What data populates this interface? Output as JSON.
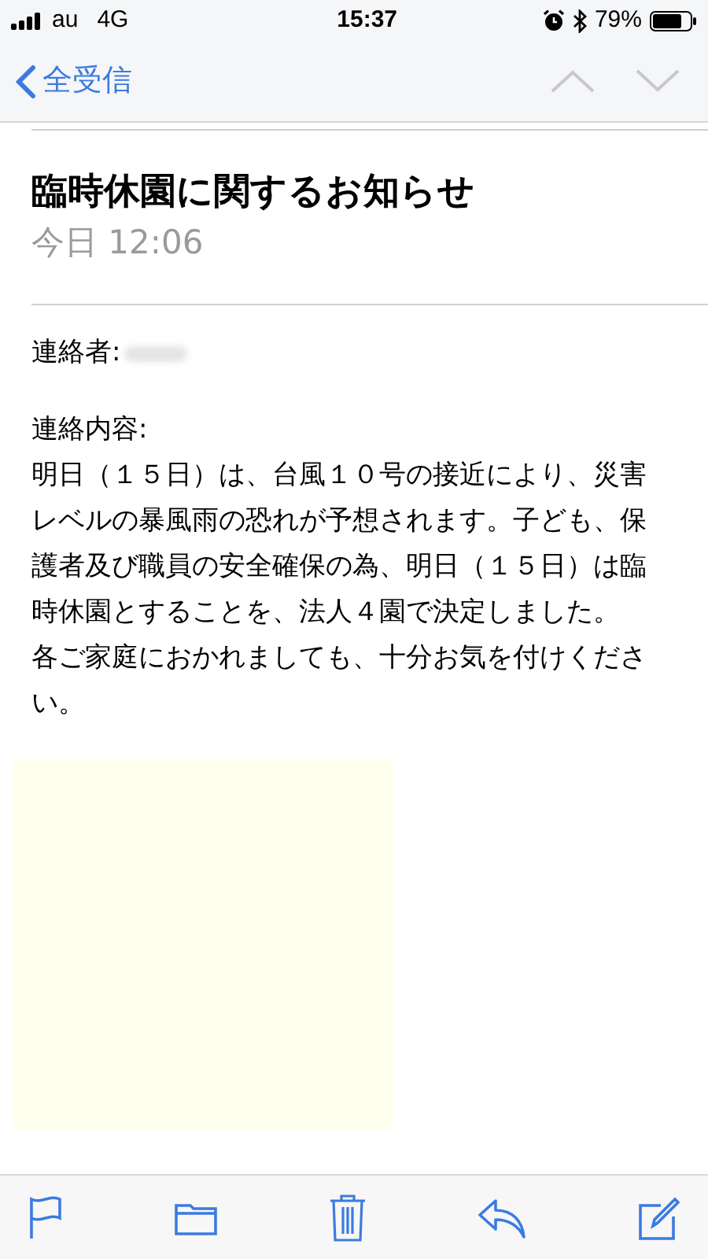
{
  "status_bar": {
    "carrier": "au",
    "network": "4G",
    "time": "15:37",
    "battery": "79%"
  },
  "nav": {
    "back_label": "全受信"
  },
  "message": {
    "subject": "臨時休園に関するお知らせ",
    "date": "今日 12:06",
    "body": [
      {
        "kind": "contact",
        "text": "連絡者:"
      },
      {
        "kind": "gap"
      },
      {
        "kind": "text",
        "text": "連絡内容:"
      },
      {
        "kind": "text",
        "text": "明日（１５日）は、台風１０号の接近により、災害レベルの暴風雨の恐れが予想されます。子ども、保護者及び職員の安全確保の為、明日（１５日）は臨時休園とすることを、法人４園で決定しました。"
      },
      {
        "kind": "text",
        "text": "各ご家庭におかれましても、十分お気を付けください。"
      },
      {
        "kind": "picture"
      }
    ]
  }
}
